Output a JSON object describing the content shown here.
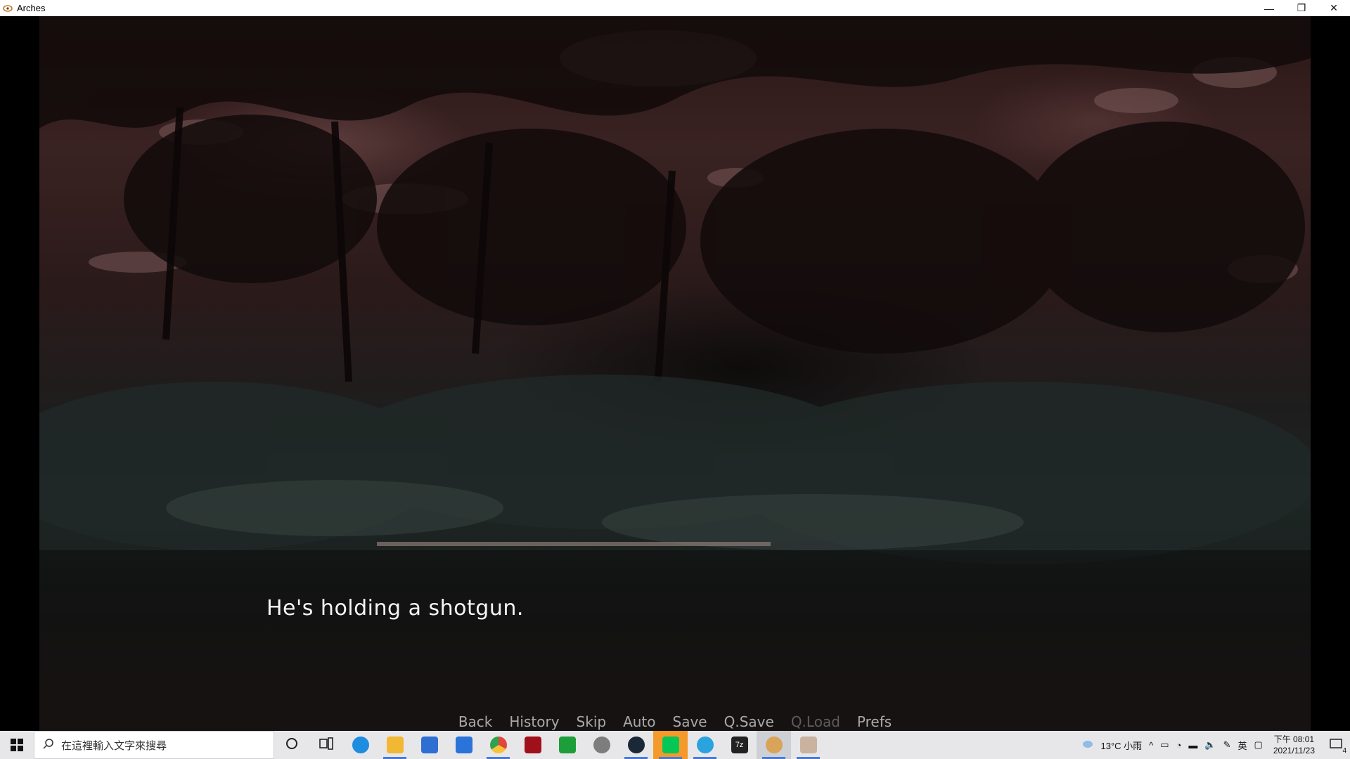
{
  "window": {
    "title": "Arches",
    "minimize": "—",
    "restore": "❐",
    "close": "✕"
  },
  "dialogue": {
    "text": "He's holding a shotgun."
  },
  "quick_menu": [
    {
      "label": "Back",
      "enabled": true
    },
    {
      "label": "History",
      "enabled": true
    },
    {
      "label": "Skip",
      "enabled": true
    },
    {
      "label": "Auto",
      "enabled": true
    },
    {
      "label": "Save",
      "enabled": true
    },
    {
      "label": "Q.Save",
      "enabled": true
    },
    {
      "label": "Q.Load",
      "enabled": false
    },
    {
      "label": "Prefs",
      "enabled": true
    }
  ],
  "taskbar": {
    "search_placeholder": "在這裡輸入文字來搜尋",
    "apps": [
      {
        "name": "cortana-icon",
        "color": "#222222"
      },
      {
        "name": "task-view-icon",
        "color": "#222222"
      },
      {
        "name": "edge-icon",
        "color": "#1d8de0"
      },
      {
        "name": "file-explorer-icon",
        "color": "#f2b733"
      },
      {
        "name": "store-icon",
        "color": "#2f6fd1"
      },
      {
        "name": "mail-icon",
        "color": "#2a73d9"
      },
      {
        "name": "chrome-icon",
        "color": "#e2453c"
      },
      {
        "name": "red-app-icon",
        "color": "#a0101a"
      },
      {
        "name": "xbox-icon",
        "color": "#1d9e3a"
      },
      {
        "name": "grey-app-icon",
        "color": "#7d7d7d"
      },
      {
        "name": "steam-icon",
        "color": "#1b2838"
      },
      {
        "name": "line-icon",
        "color": "#06c755"
      },
      {
        "name": "telegram-icon",
        "color": "#2aa3de"
      },
      {
        "name": "7zip-icon",
        "color": "#222222"
      },
      {
        "name": "arches-game-icon",
        "color": "#d9a35a"
      },
      {
        "name": "paint-app-icon",
        "color": "#c9b3a0"
      }
    ],
    "weather": "13°C 小雨",
    "ime_lang": "英",
    "time": "下午 08:01",
    "date": "2021/11/23",
    "notification_count": "4"
  }
}
